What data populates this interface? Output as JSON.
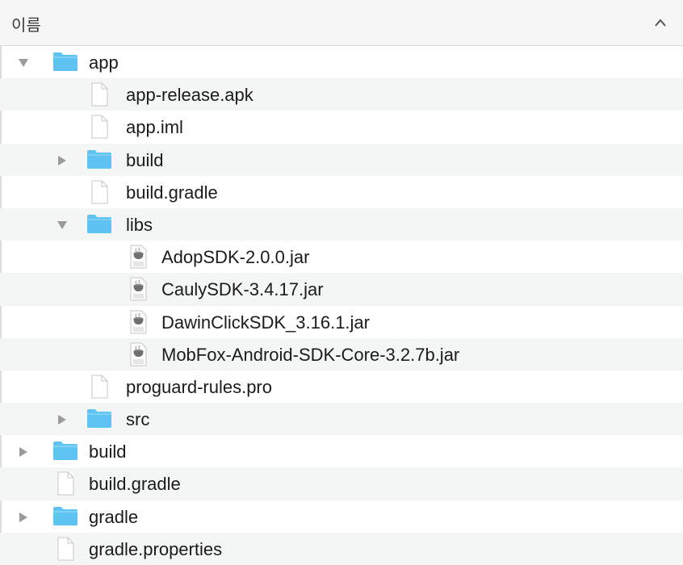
{
  "header": {
    "name_column": "이름",
    "sort_icon": "chevron-up-icon"
  },
  "colors": {
    "folder": "#5ec3f1",
    "header_bg": "#f6f6f6",
    "alt_row": "#f4f5f5"
  },
  "rows": [
    {
      "label": "app",
      "type": "folder",
      "level": 0,
      "expanded": true
    },
    {
      "label": "app-release.apk",
      "type": "file",
      "level": 1
    },
    {
      "label": "app.iml",
      "type": "file",
      "level": 1
    },
    {
      "label": "build",
      "type": "folder",
      "level": 1,
      "expanded": false
    },
    {
      "label": "build.gradle",
      "type": "file",
      "level": 1
    },
    {
      "label": "libs",
      "type": "folder",
      "level": 1,
      "expanded": true
    },
    {
      "label": "AdopSDK-2.0.0.jar",
      "type": "jar",
      "level": 2
    },
    {
      "label": "CaulySDK-3.4.17.jar",
      "type": "jar",
      "level": 2
    },
    {
      "label": "DawinClickSDK_3.16.1.jar",
      "type": "jar",
      "level": 2
    },
    {
      "label": "MobFox-Android-SDK-Core-3.2.7b.jar",
      "type": "jar",
      "level": 2
    },
    {
      "label": "proguard-rules.pro",
      "type": "file",
      "level": 1
    },
    {
      "label": "src",
      "type": "folder",
      "level": 1,
      "expanded": false
    },
    {
      "label": "build",
      "type": "folder",
      "level": 0,
      "expanded": false
    },
    {
      "label": "build.gradle",
      "type": "file",
      "level": 0
    },
    {
      "label": "gradle",
      "type": "folder",
      "level": 0,
      "expanded": false
    },
    {
      "label": "gradle.properties",
      "type": "file",
      "level": 0
    }
  ]
}
